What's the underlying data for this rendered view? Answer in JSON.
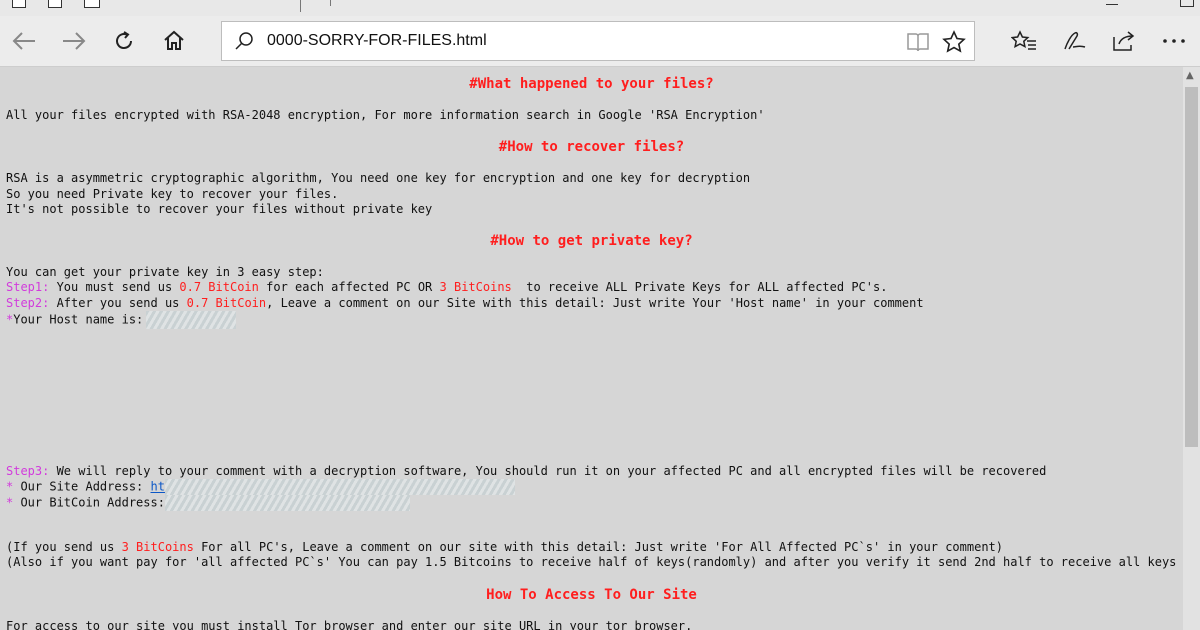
{
  "browser": {
    "address": "0000-SORRY-FOR-FILES.html",
    "icons": [
      "back-icon",
      "forward-icon",
      "refresh-icon",
      "home-icon",
      "search-icon",
      "reading-view-icon",
      "favorite-star-icon",
      "favorites-hub-icon",
      "web-note-icon",
      "share-icon",
      "more-icon"
    ]
  },
  "page": {
    "h1": "#What happened to your files?",
    "p1": "All your files encrypted with RSA-2048 encryption, For more information search in Google 'RSA Encryption'",
    "h2": "#How to recover files?",
    "p2a": "RSA is a asymmetric cryptographic algorithm, You need one key for encryption and one key for decryption",
    "p2b": "So you need Private key to recover your files.",
    "p2c": "It's not possible to recover your files without private key",
    "h3": "#How to get private key?",
    "p3": "You can get your private key in 3 easy step:",
    "step1": {
      "label": "Step1:",
      "t1": " You must send us ",
      "amount1": "0.7 BitCoin",
      "t2": " for each affected PC OR ",
      "amount2": "3 BitCoins",
      "t3": "  to receive ALL Private Keys for ALL affected PC's."
    },
    "step2": {
      "label": "Step2:",
      "t1": " After you send us ",
      "amount": "0.7 BitCoin",
      "t2": ", Leave a comment on our Site with this detail: Just write Your 'Host name' in your comment"
    },
    "host": {
      "star": "*",
      "label": "Your Host name is:"
    },
    "step3": {
      "label": "Step3:",
      "text": " We will reply to your comment with a decryption software, You should run it on your affected PC and all encrypted files will be recovered"
    },
    "site": {
      "star": "*",
      "label": " Our Site Address: ",
      "link": "ht"
    },
    "btc": {
      "star": "*",
      "label": " Our BitCoin Address:"
    },
    "p4": {
      "t1": "(If you send us ",
      "amount": "3 BitCoins",
      "t2": " For all PC's, Leave a comment on our site with this detail: Just write 'For All Affected PC`s' in your comment)"
    },
    "p5": "(Also if you want pay for 'all affected PC`s' You can pay 1.5 Bitcoins to receive half of keys(randomly) and after you verify it send 2nd half to receive all keys )",
    "h4": "How To Access To Our Site",
    "p6": "For access to our site you must install Tor browser and enter our site URL in your tor browser."
  },
  "colors": {
    "heading": "#ff1e1e",
    "amount": "#ff1e1e",
    "step": "#d23cdc",
    "star": "#d23cdc",
    "link": "#0b57c7",
    "background": "#d6d6d6"
  }
}
